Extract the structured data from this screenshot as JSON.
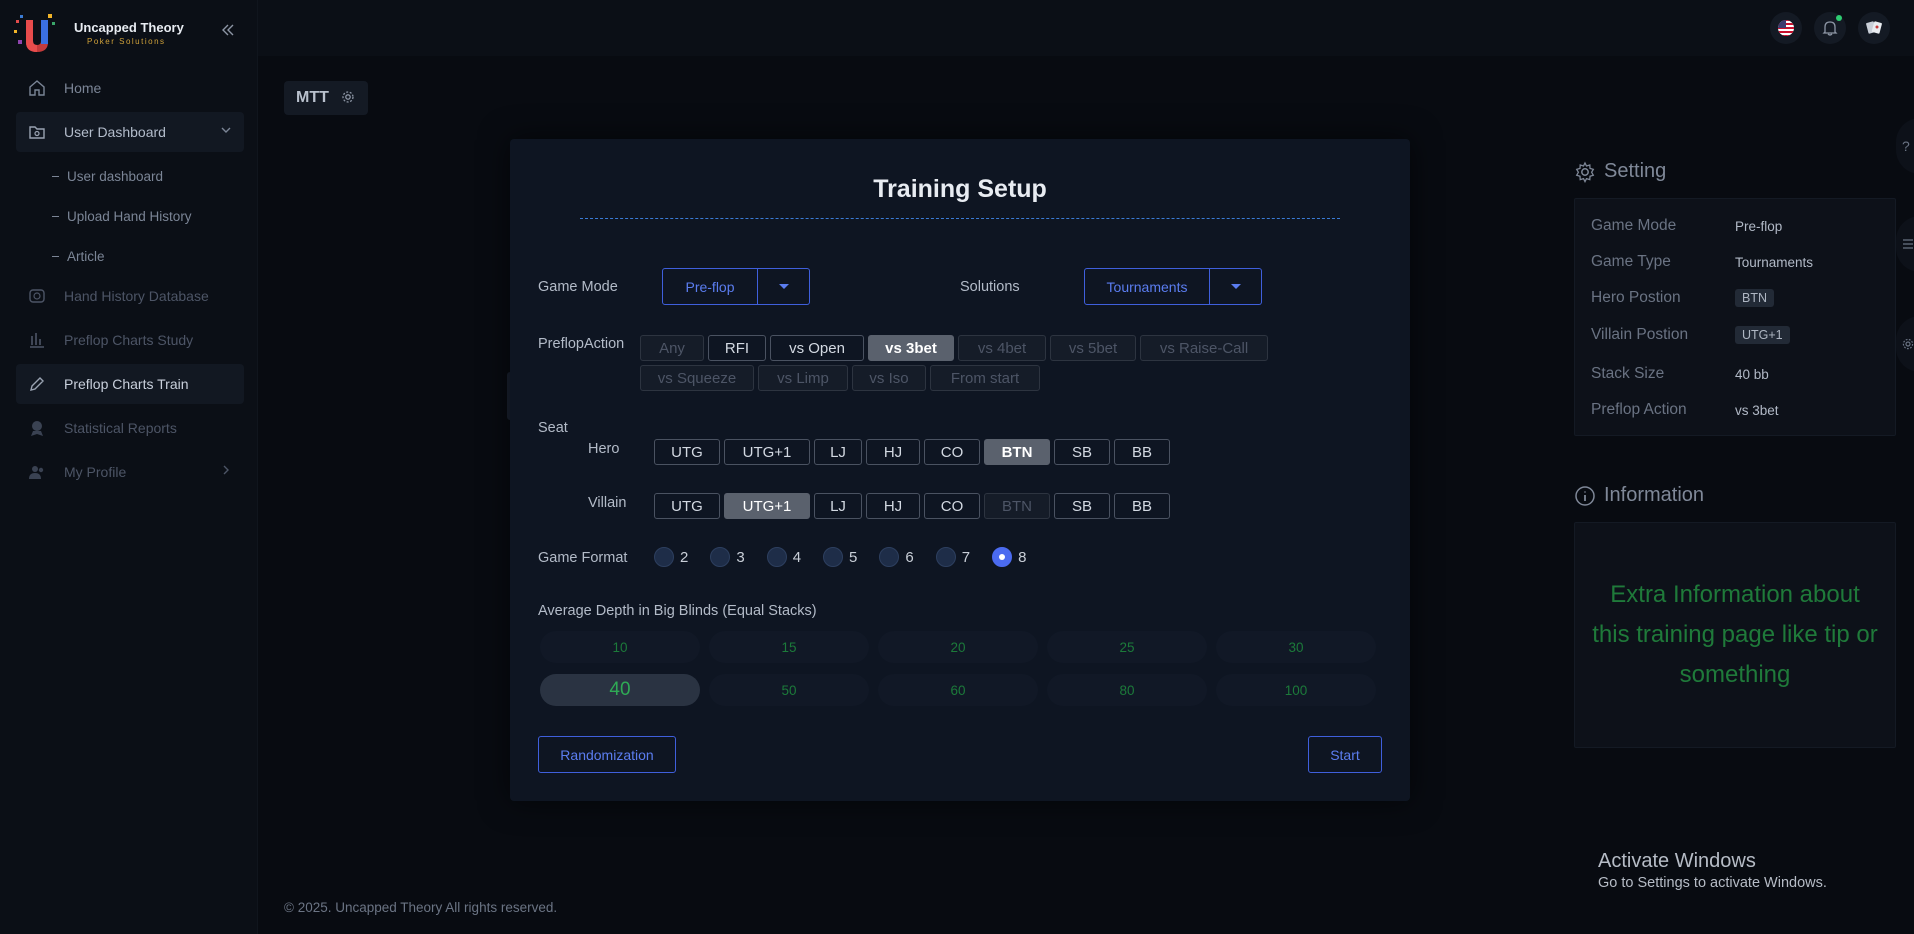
{
  "brand": {
    "title": "Uncapped Theory",
    "subtitle": "Poker Solutions"
  },
  "sidebar": {
    "items": [
      {
        "label": "Home",
        "icon": "home-icon"
      },
      {
        "label": "User Dashboard",
        "icon": "folder-icon"
      },
      {
        "label": "Hand History Database",
        "icon": "database-icon"
      },
      {
        "label": "Preflop Charts Study",
        "icon": "bar-chart-icon"
      },
      {
        "label": "Preflop Charts Train",
        "icon": "pencil-icon"
      },
      {
        "label": "Statistical Reports",
        "icon": "report-icon"
      },
      {
        "label": "My Profile",
        "icon": "users-icon"
      }
    ],
    "subitems": [
      {
        "label": "User dashboard"
      },
      {
        "label": "Upload Hand History"
      },
      {
        "label": "Article"
      }
    ]
  },
  "tab": {
    "label": "MTT"
  },
  "footer": {
    "text": "© 2025. Uncapped Theory All rights reserved."
  },
  "modal": {
    "title": "Training Setup",
    "game_mode": {
      "label": "Game Mode",
      "value": "Pre-flop"
    },
    "solutions": {
      "label": "Solutions",
      "value": "Tournaments"
    },
    "preflop_action": {
      "label": "PreflopAction",
      "row1": [
        "Any",
        "RFI",
        "vs Open",
        "vs 3bet",
        "vs 4bet",
        "vs 5bet",
        "vs Raise-Call"
      ],
      "row2": [
        "vs Squeeze",
        "vs Limp",
        "vs Iso",
        "From start"
      ],
      "selected": "vs 3bet"
    },
    "seat": {
      "label": "Seat",
      "hero_label": "Hero",
      "villain_label": "Villain",
      "positions": [
        "UTG",
        "UTG+1",
        "LJ",
        "HJ",
        "CO",
        "BTN",
        "SB",
        "BB"
      ],
      "hero_selected": "BTN",
      "villain_selected": "UTG+1",
      "villain_disabled": "BTN"
    },
    "game_format": {
      "label": "Game Format",
      "options": [
        "2",
        "3",
        "4",
        "5",
        "6",
        "7",
        "8"
      ],
      "selected": "8"
    },
    "depth": {
      "label": "Average Depth in Big Blinds (Equal Stacks)",
      "options": [
        "10",
        "15",
        "20",
        "25",
        "30",
        "40",
        "50",
        "60",
        "80",
        "100"
      ],
      "selected": "40"
    },
    "randomization_label": "Randomization",
    "start_label": "Start"
  },
  "settings": {
    "title": "Setting",
    "rows": [
      {
        "key": "Game Mode",
        "value": "Pre-flop"
      },
      {
        "key": "Game Type",
        "value": "Tournaments"
      },
      {
        "key": "Hero Postion",
        "value": "BTN"
      },
      {
        "key": "Villain Postion",
        "value": "UTG+1"
      },
      {
        "key": "Stack Size",
        "value": "40 bb"
      },
      {
        "key": "Preflop Action",
        "value": "vs 3bet"
      }
    ]
  },
  "information": {
    "title": "Information",
    "text": "Extra Information about this training page like tip or something"
  },
  "windows": {
    "title": "Activate Windows",
    "subtitle": "Go to Settings to activate Windows."
  },
  "right_tabs": [
    "?",
    "list-icon",
    "gear-icon"
  ],
  "colors": {
    "accent": "#3f5fdc",
    "green": "#1f7a3a",
    "background": "#080b11",
    "modal": "#0e1522"
  }
}
